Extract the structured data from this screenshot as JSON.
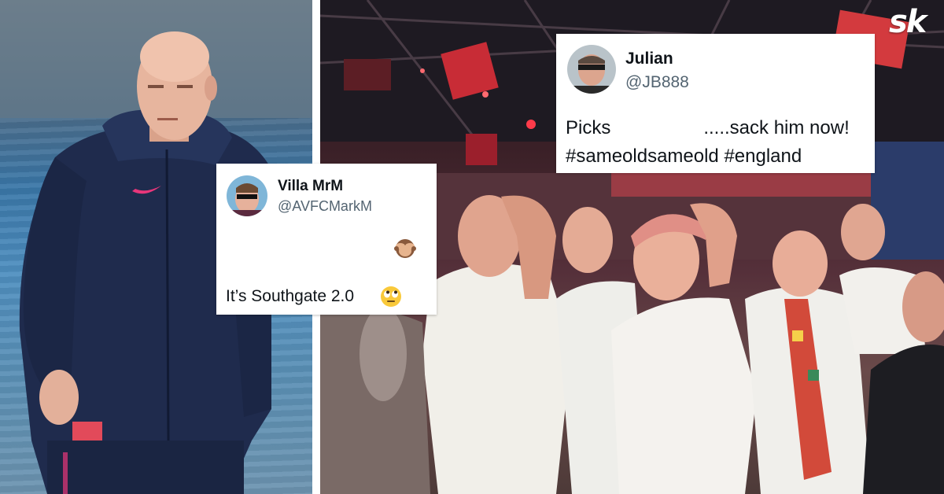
{
  "brand": {
    "logo_text": "sk"
  },
  "tweets": [
    {
      "name": "Villa MrM",
      "handle": "@AVFCMarkM",
      "emoji_icon": "see-no-evil-monkey-icon",
      "text": "It’s Southgate 2.0",
      "text_emoji_icon": "face-with-rolling-eyes-icon"
    },
    {
      "name": "Julian",
      "handle": "@JB888",
      "line1_a": "Picks",
      "line1_b": ".....sack him now!",
      "hashtags": "#sameoldsameold #england"
    }
  ],
  "colors": {
    "hashtag": "#1d9bf0",
    "handle": "#536471",
    "text": "#0f1419",
    "jacket": "#1f2b4d"
  }
}
